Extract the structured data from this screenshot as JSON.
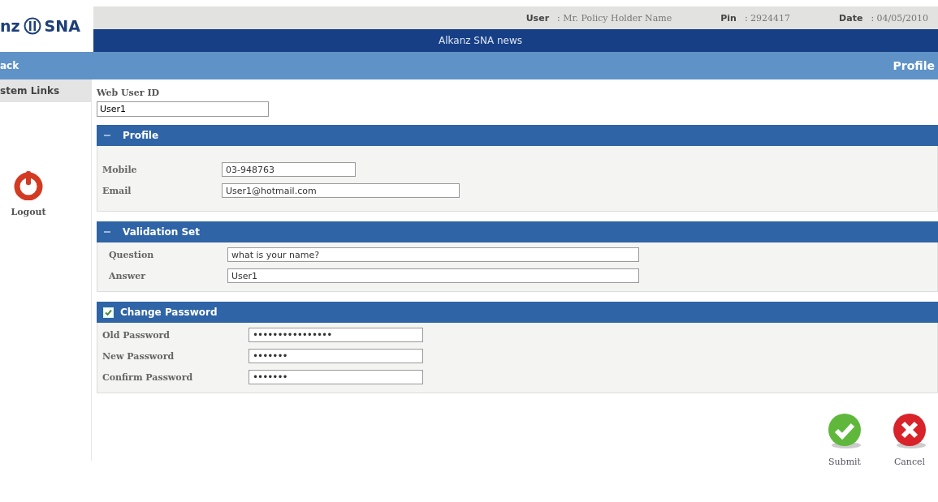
{
  "logo": {
    "left": "nz",
    "right": "SNA"
  },
  "info_bar": [
    {
      "label": "User",
      "value": ": Mr. Policy Holder Name"
    },
    {
      "label": "Pin",
      "value": ": 2924417"
    },
    {
      "label": "Date",
      "value": ": 04/05/2010"
    }
  ],
  "news_bar": {
    "text": "Alkanz SNA news"
  },
  "nav_bar": {
    "back": "ack",
    "title": "Profile"
  },
  "sidebar": {
    "header": "stem Links",
    "logout": "Logout"
  },
  "web_user_id": {
    "label": "Web User ID",
    "value": "User1"
  },
  "sections": [
    {
      "kind": "collapse",
      "title": "Profile",
      "expanded": true,
      "fields": [
        {
          "label": "Mobile",
          "value": "03-948763"
        },
        {
          "label": "Email",
          "value": "User1@hotmail.com"
        }
      ]
    },
    {
      "kind": "collapse",
      "title": "Validation Set",
      "expanded": true,
      "fields": [
        {
          "label": "Question",
          "value": "what is your name?"
        },
        {
          "label": "Answer",
          "value": "User1"
        }
      ]
    },
    {
      "kind": "checkbox",
      "title": "Change Password",
      "checked": true,
      "fields": [
        {
          "label": "Old Password",
          "value": "••••••••••••••••"
        },
        {
          "label": "New Password",
          "value": "•••••••"
        },
        {
          "label": "Confirm Password",
          "value": "•••••••"
        }
      ]
    }
  ],
  "actions": [
    {
      "kind": "submit",
      "label": "Submit"
    },
    {
      "kind": "cancel",
      "label": "Cancel"
    }
  ]
}
